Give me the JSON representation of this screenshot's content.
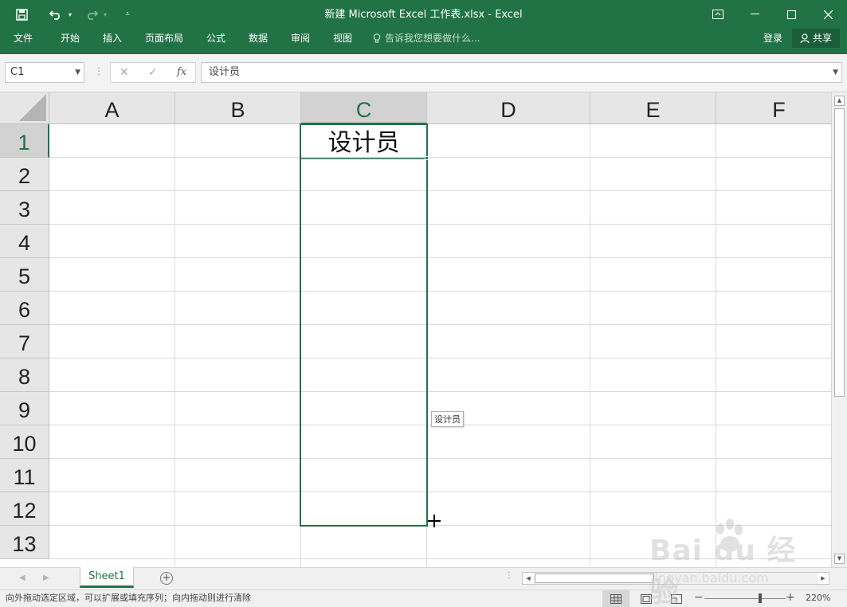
{
  "window": {
    "title": "新建 Microsoft Excel 工作表.xlsx - Excel"
  },
  "ribbon": {
    "tabs": [
      "文件",
      "开始",
      "插入",
      "页面布局",
      "公式",
      "数据",
      "审阅",
      "视图"
    ],
    "tell_me": "告诉我您想要做什么...",
    "login": "登录",
    "share": "共享"
  },
  "formula_bar": {
    "name_box": "C1",
    "fx": "fx",
    "content": "设计员"
  },
  "grid": {
    "columns": [
      "A",
      "B",
      "C",
      "D",
      "E",
      "F"
    ],
    "rows": [
      "1",
      "2",
      "3",
      "4",
      "5",
      "6",
      "7",
      "8",
      "9",
      "10",
      "11",
      "12",
      "13"
    ],
    "selected_column": "C",
    "selected_row": "1",
    "cells": {
      "C1": "设计员"
    },
    "drag_tooltip": "设计员"
  },
  "sheets": {
    "tabs": [
      "Sheet1"
    ],
    "active": "Sheet1"
  },
  "status_bar": {
    "message": "向外拖动选定区域，可以扩展或填充序列；向内拖动则进行清除",
    "zoom": "220%"
  },
  "watermark": {
    "brand": "Bai du 经验",
    "url": "jingyan.baidu.com"
  },
  "colors": {
    "accent": "#217346",
    "ribbon_bg": "#217346",
    "grid_line": "#dadada",
    "header_bg": "#e6e6e6"
  }
}
